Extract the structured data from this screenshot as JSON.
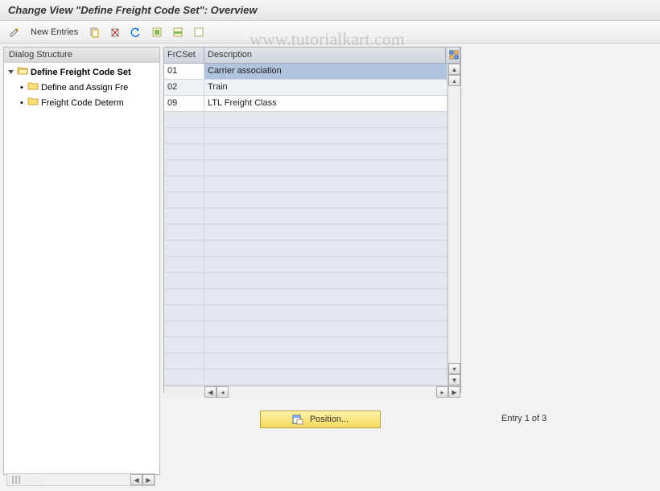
{
  "title": "Change View \"Define Freight Code Set\": Overview",
  "toolbar": {
    "new_entries_label": "New Entries"
  },
  "dialog_structure": {
    "header": "Dialog Structure",
    "nodes": [
      {
        "label": "Define Freight Code Set",
        "selected": true,
        "open": true
      },
      {
        "label": "Define and Assign Fre",
        "selected": false,
        "child": true
      },
      {
        "label": "Freight Code Determ",
        "selected": false,
        "child": true
      }
    ]
  },
  "grid": {
    "columns": {
      "frc": "FrCSet",
      "desc": "Description"
    },
    "rows": [
      {
        "frc": "01",
        "desc": "Carrier association",
        "selected": true
      },
      {
        "frc": "02",
        "desc": "Train",
        "selected": false
      },
      {
        "frc": "09",
        "desc": "LTL Freight Class",
        "selected": false
      }
    ],
    "empty_rows": 17
  },
  "position_button": "Position...",
  "entry_info": "Entry 1 of 3",
  "watermark": "www.tutorialkart.com"
}
